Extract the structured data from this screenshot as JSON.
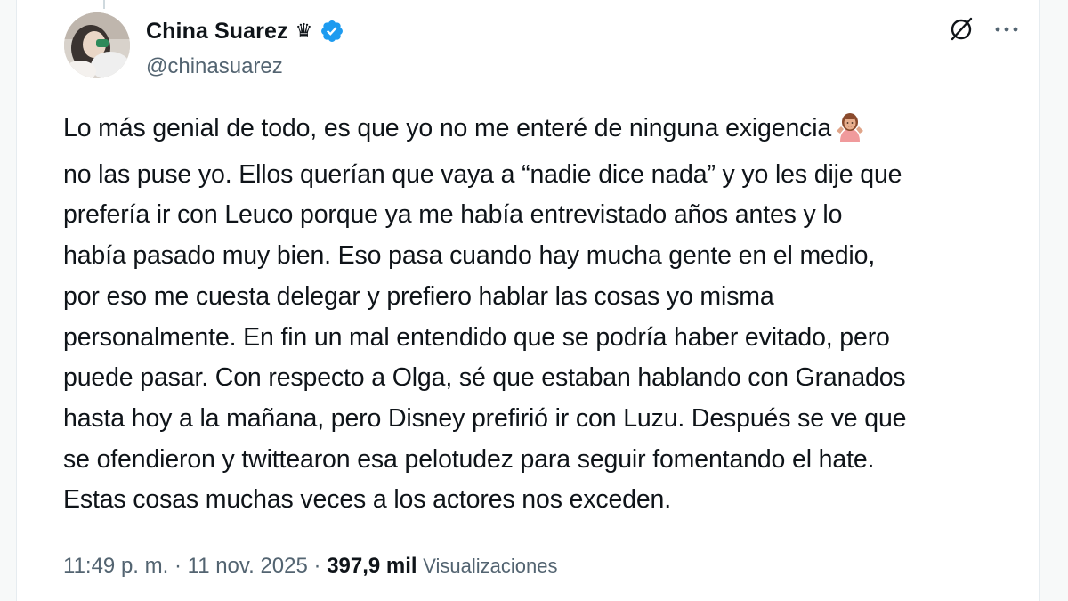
{
  "author": {
    "display_name": "China Suarez",
    "crown": "♛",
    "handle": "@chinasuarez",
    "verified_color": "#1d9bf0",
    "avatar_icon": "profile-photo"
  },
  "actions": {
    "grok_icon": "grok-icon",
    "more_icon": "more-icon",
    "more_label": "···"
  },
  "tweet": {
    "lines": [
      "Lo más genial de todo, es que yo no me enteré de ninguna exigencia",
      "no las puse yo. Ellos querían que vaya a “nadie dice nada” y yo les dije que",
      "prefería ir con Leuco porque ya me había entrevistado años antes y lo",
      "había pasado muy bien. Eso pasa cuando hay mucha gente en el medio,",
      "por eso me cuesta delegar y prefiero hablar las cosas yo misma",
      "personalmente. En fin un mal entendido que se podría haber evitado, pero",
      "puede pasar. Con respecto a Olga, sé que estaban hablando con Granados",
      "hasta hoy a la mañana, pero Disney prefirió ir con Luzu. Después se ve que",
      "se ofendieron y twittearon esa pelotudez para seguir fomentando el hate.",
      "Estas cosas muchas veces a los actores nos exceden."
    ],
    "emoji": "woman-shrugging-emoji"
  },
  "meta": {
    "time": "11:49 p. m.",
    "separator": " · ",
    "date": "11 nov. 2025",
    "views_count": "397,9 mil",
    "views_label": "Visualizaciones"
  }
}
